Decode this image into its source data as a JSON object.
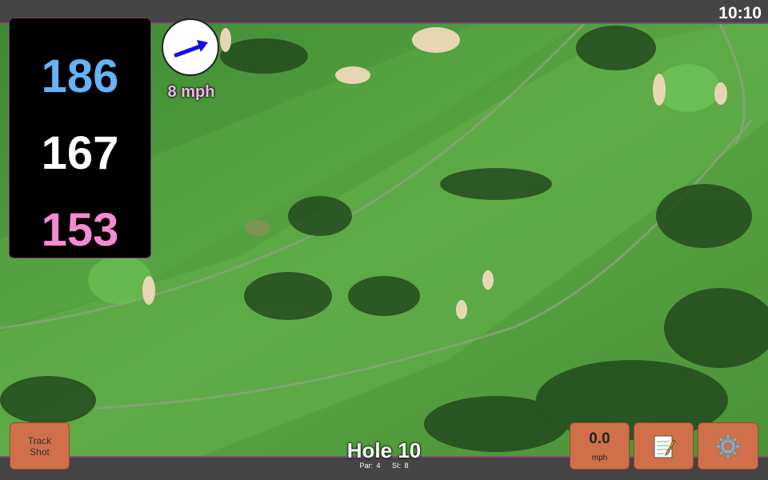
{
  "status_bar": {
    "time": "10:10"
  },
  "distances": {
    "back": "186",
    "middle": "167",
    "front": "153"
  },
  "wind": {
    "speed": "8 mph",
    "arrow_icon": "wind-direction-arrow"
  },
  "hole": {
    "title": "Hole 10",
    "par": "Par: 4",
    "stroke_index": "SI: 8"
  },
  "buttons": {
    "track_shot": "Track Shot",
    "speed_value": "0.0",
    "speed_unit": "mph",
    "notes_icon": "notepad-icon",
    "settings_icon": "gear-icon"
  },
  "colors": {
    "back_distance": "#66b2f5",
    "middle_distance": "#ffffff",
    "front_distance": "#f48ad0",
    "button": "#d0704a",
    "wind_text": "#f3b6ee",
    "wind_arrow": "#1010e0"
  }
}
